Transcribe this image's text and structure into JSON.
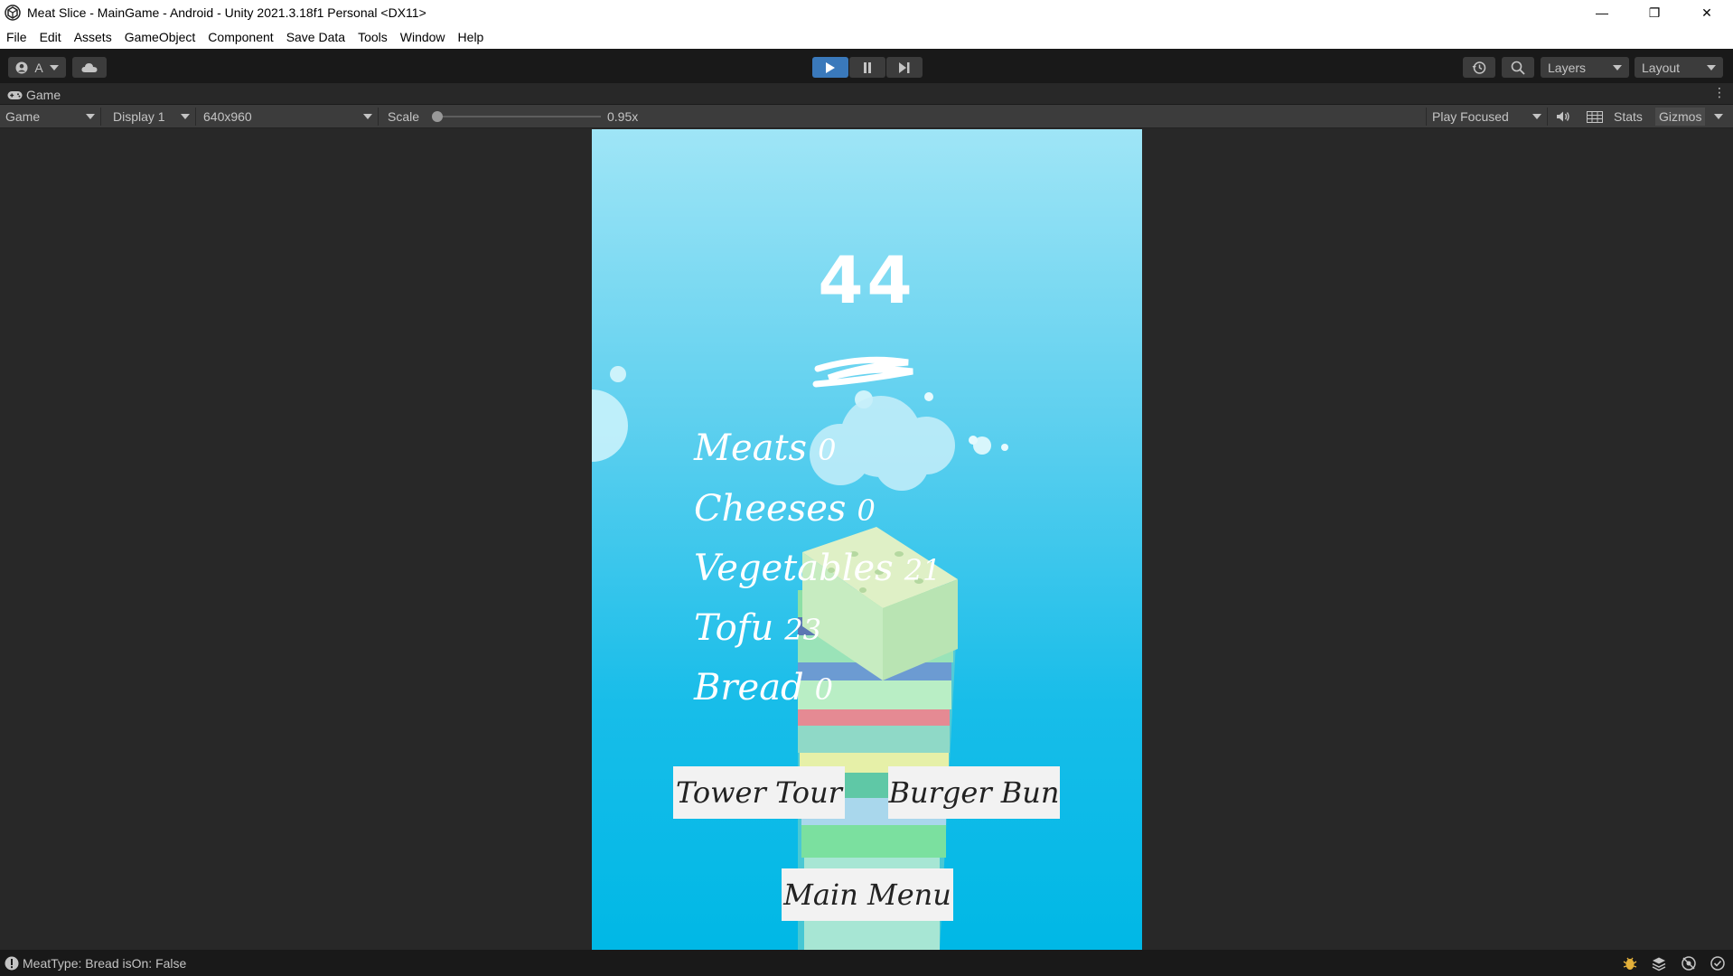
{
  "window": {
    "title": "Meat Slice - MainGame - Android - Unity 2021.3.18f1 Personal <DX11>",
    "minimize_glyph": "—",
    "maximize_glyph": "❐",
    "close_glyph": "✕"
  },
  "menu": [
    "File",
    "Edit",
    "Assets",
    "GameObject",
    "Component",
    "Save Data",
    "Tools",
    "Window",
    "Help"
  ],
  "toolbar": {
    "account_label": "A",
    "layers_label": "Layers",
    "layout_label": "Layout"
  },
  "game_tab": {
    "label": "Game"
  },
  "game_view_toolbar": {
    "view_mode": "Game",
    "display": "Display 1",
    "resolution": "640x960",
    "scale_label": "Scale",
    "scale_value": "0.95x",
    "play_mode": "Play Focused",
    "stats_label": "Stats",
    "gizmos_label": "Gizmos"
  },
  "game": {
    "score": "44",
    "stats": [
      {
        "label": "Meats",
        "value": "0"
      },
      {
        "label": "Cheeses",
        "value": "0"
      },
      {
        "label": "Vegetables",
        "value": "21"
      },
      {
        "label": "Tofu",
        "value": "23"
      },
      {
        "label": "Bread",
        "value": "0"
      }
    ],
    "buttons": {
      "tower_tour": "Tower Tour",
      "burger_bun": "Burger Bun",
      "main_menu": "Main Menu"
    }
  },
  "status": {
    "message": "MeatType: Bread isOn: False"
  },
  "colors": {
    "editor_bg": "#282828",
    "toolbar_bg": "#191919",
    "play_active": "#3a79bb",
    "sky_top": "#9fe5f6",
    "sky_bottom": "#00b8e6"
  },
  "icons": [
    "unity-logo-icon",
    "account-icon",
    "cloud-icon",
    "play-icon",
    "pause-icon",
    "step-icon",
    "history-icon",
    "search-icon",
    "gamepad-icon",
    "speaker-icon",
    "grid-icon",
    "warning-icon",
    "bug-icon",
    "layers-stack-icon",
    "network-icon",
    "check-icon"
  ]
}
